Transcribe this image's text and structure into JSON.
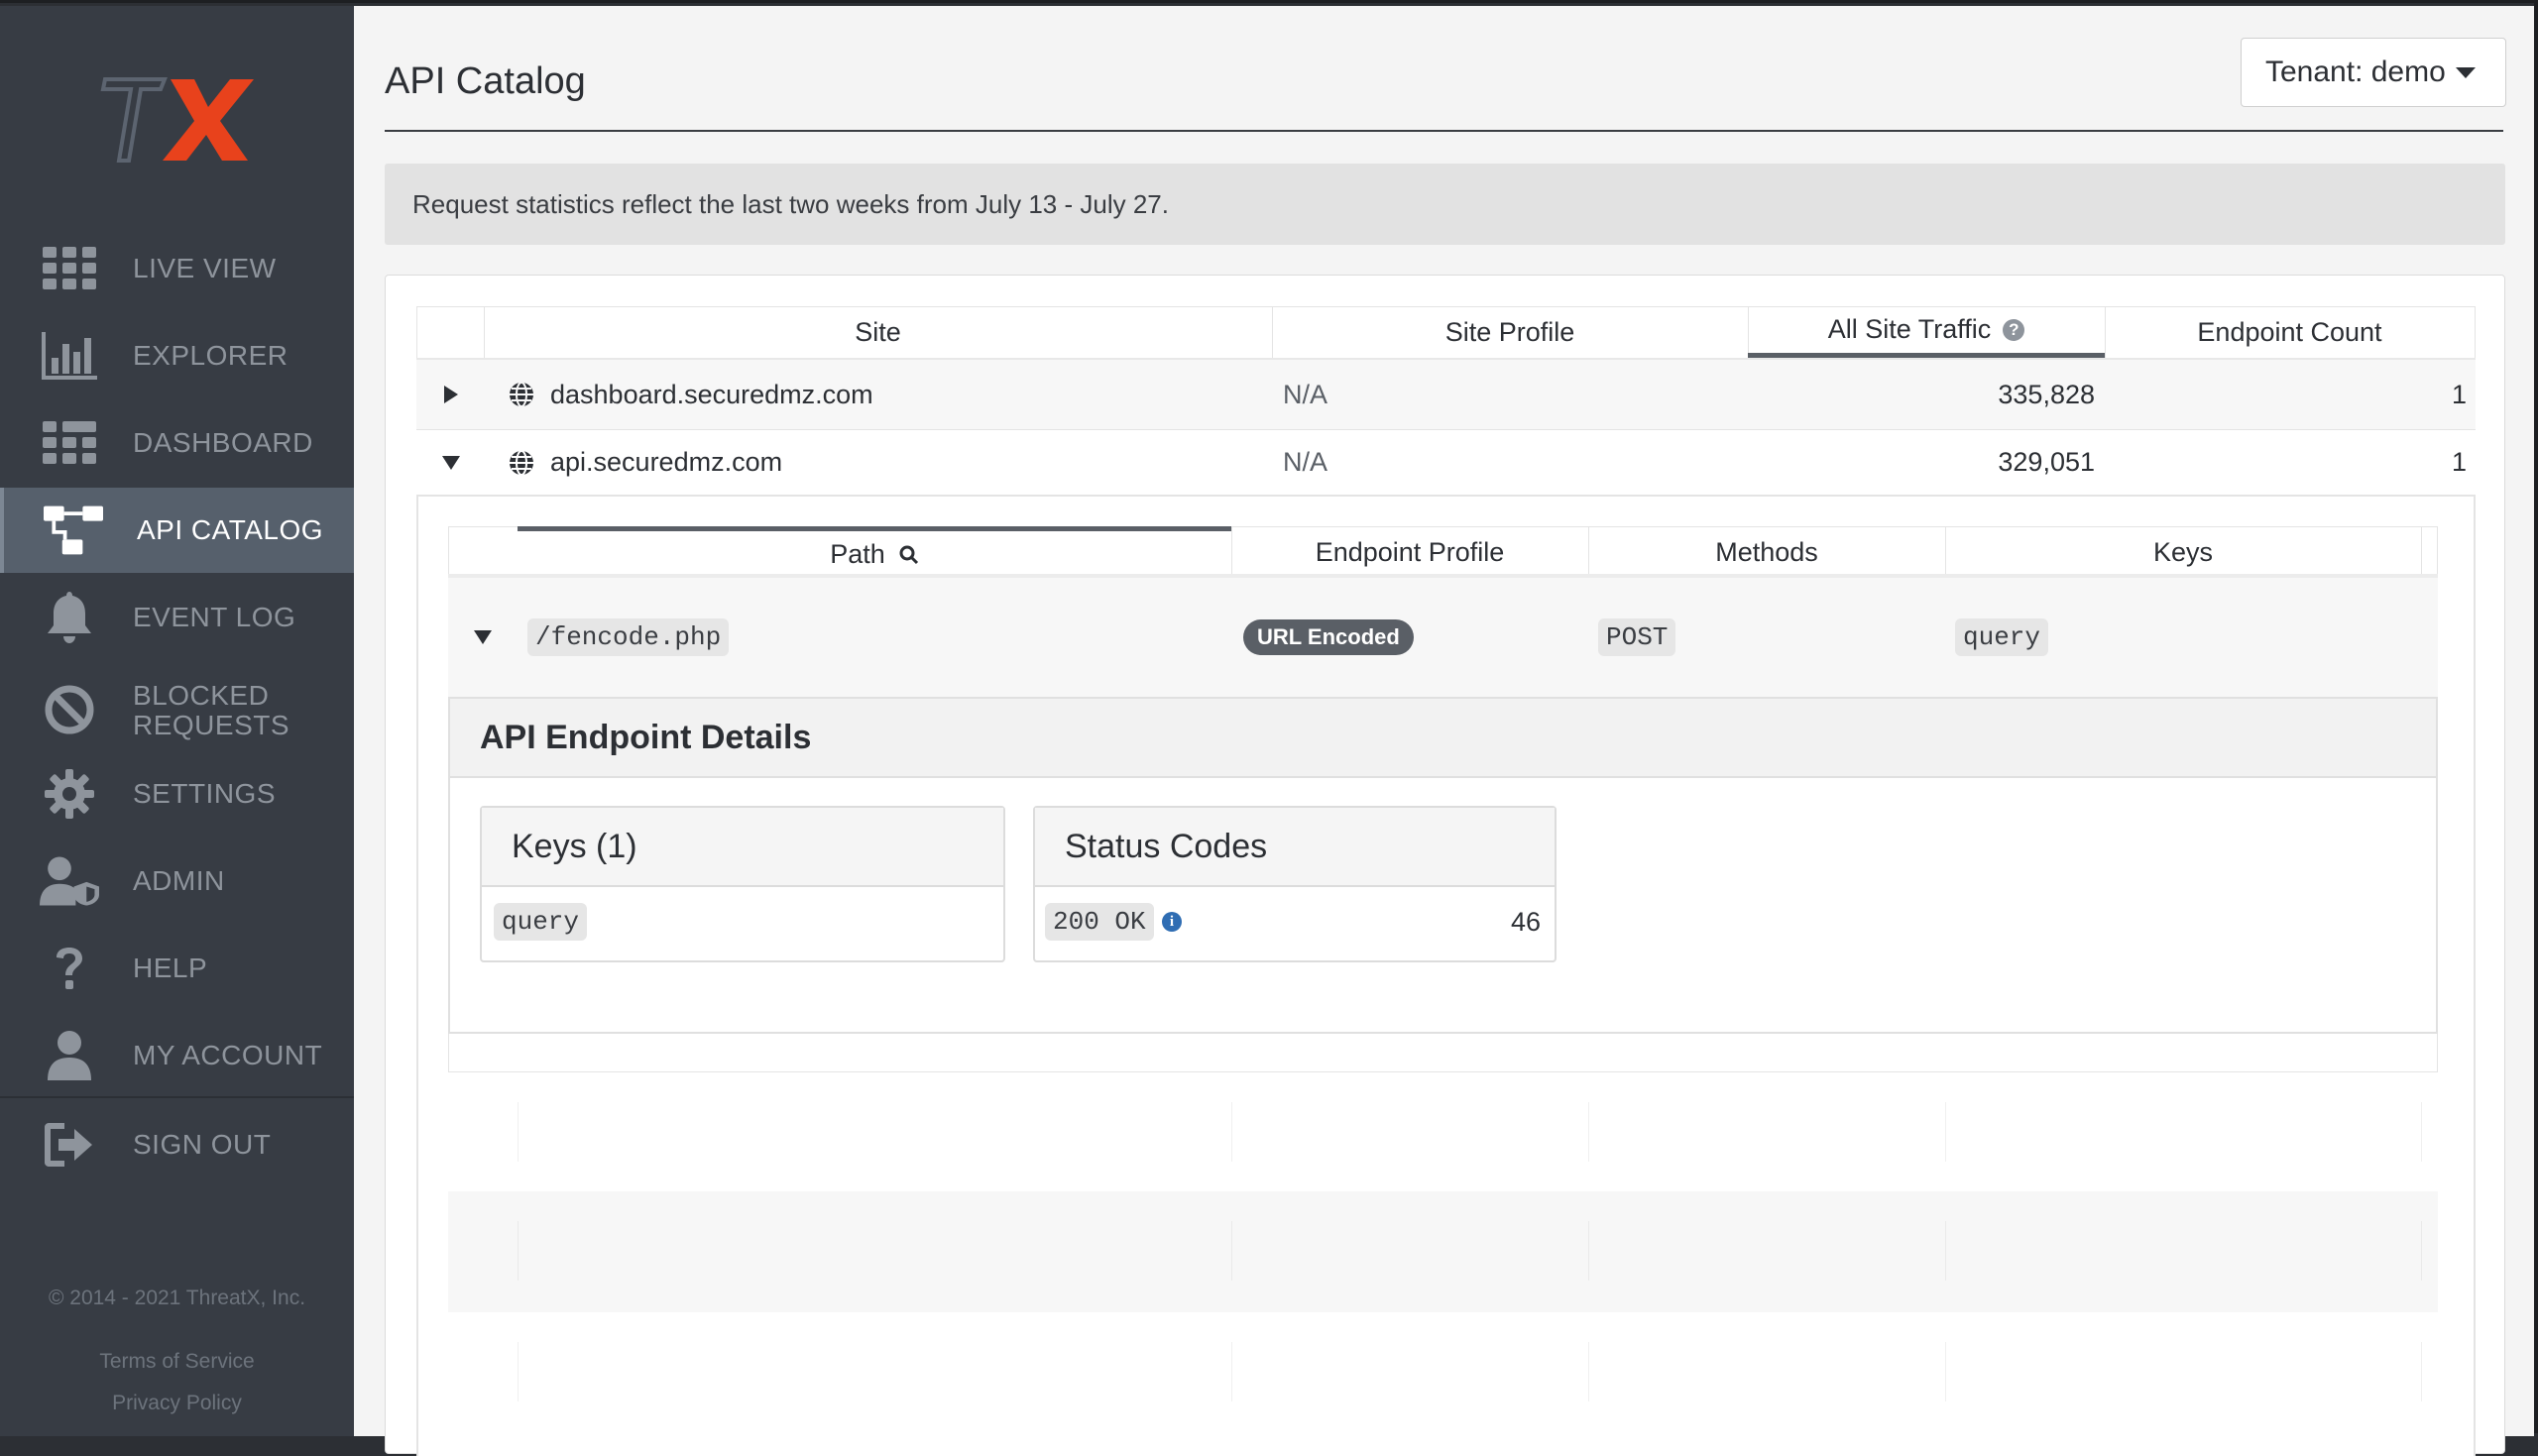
{
  "sidebar": {
    "logo_text": "TX",
    "nav": [
      {
        "label": "LIVE VIEW",
        "icon": "grid-icon"
      },
      {
        "label": "EXPLORER",
        "icon": "bar-chart-icon"
      },
      {
        "label": "DASHBOARD",
        "icon": "dashboard-grid-icon"
      },
      {
        "label": "API CATALOG",
        "icon": "api-tree-icon",
        "active": true
      },
      {
        "label": "EVENT LOG",
        "icon": "bell-icon"
      },
      {
        "label": "BLOCKED REQUESTS",
        "label_line1": "BLOCKED",
        "label_line2": "REQUESTS",
        "icon": "blocked-icon"
      },
      {
        "label": "SETTINGS",
        "icon": "gear-icon"
      },
      {
        "label": "ADMIN",
        "icon": "admin-user-shield-icon"
      },
      {
        "label": "HELP",
        "icon": "question-icon"
      },
      {
        "label": "MY ACCOUNT",
        "icon": "user-icon"
      },
      {
        "label": "SIGN OUT",
        "icon": "sign-out-icon"
      }
    ],
    "copyright": "© 2014 - 2021 ThreatX, Inc.",
    "terms": "Terms of Service",
    "privacy": "Privacy Policy"
  },
  "header": {
    "title": "API Catalog",
    "tenant_label": "Tenant: demo"
  },
  "notice": "Request statistics reflect the last two weeks from July 13 - July 27.",
  "sites_table": {
    "columns": [
      "Site",
      "Site Profile",
      "All Site Traffic",
      "Endpoint Count"
    ],
    "rows": [
      {
        "site": "dashboard.securedmz.com",
        "profile": "N/A",
        "traffic": "335,828",
        "count": "1",
        "expanded": false
      },
      {
        "site": "api.securedmz.com",
        "profile": "N/A",
        "traffic": "329,051",
        "count": "1",
        "expanded": true
      }
    ]
  },
  "endpoints_table": {
    "columns": [
      "Path",
      "Endpoint Profile",
      "Methods",
      "Keys"
    ],
    "rows": [
      {
        "path": "/fencode.php",
        "profile": "URL Encoded",
        "method": "POST",
        "key": "query"
      }
    ]
  },
  "details": {
    "title": "API Endpoint Details",
    "keys_title": "Keys (1)",
    "keys": [
      "query"
    ],
    "status_title": "Status Codes",
    "status_codes": [
      {
        "code": "200 OK",
        "count": "46"
      }
    ]
  },
  "colors": {
    "sidebar_bg": "#373c44",
    "sidebar_active": "#56606c",
    "brand_red": "#e8421c",
    "brand_gray": "#5c6470"
  }
}
